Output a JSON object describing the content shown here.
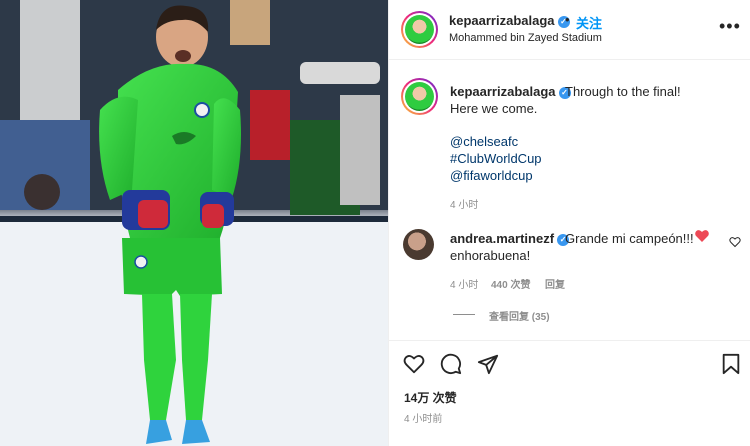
{
  "post": {
    "username": "kepaarrizabalaga",
    "verified": true,
    "follow_label": "关注",
    "separator": "•",
    "location": "Mohammed bin Zayed Stadium",
    "more_icon": "more-horizontal-icon"
  },
  "caption": {
    "username": "kepaarrizabalaga",
    "text_line1": "Through to the final!",
    "text_line2": "Here we come.",
    "tags": [
      "@chelseafc",
      "#ClubWorldCup",
      "@fifaworldcup"
    ],
    "time": "4 小时"
  },
  "comment": {
    "username": "andrea.martinezf",
    "verified": true,
    "text_line1": "Grande mi campeón!!!",
    "text_line2": "enhorabuena!",
    "emoji": "red-heart-icon",
    "time": "4 小时",
    "likes": "440 次赞",
    "reply_label": "回复",
    "view_replies": "查看回复 (35)"
  },
  "actions": {
    "icons": [
      "heart-icon",
      "comment-icon",
      "share-icon",
      "bookmark-icon"
    ],
    "likes": "14万 次赞",
    "time": "4 小时前"
  },
  "colors": {
    "accent": "#0095f6",
    "verified": "#3897f0",
    "heart": "#ed4956",
    "kit_green": "#2fd33d"
  }
}
